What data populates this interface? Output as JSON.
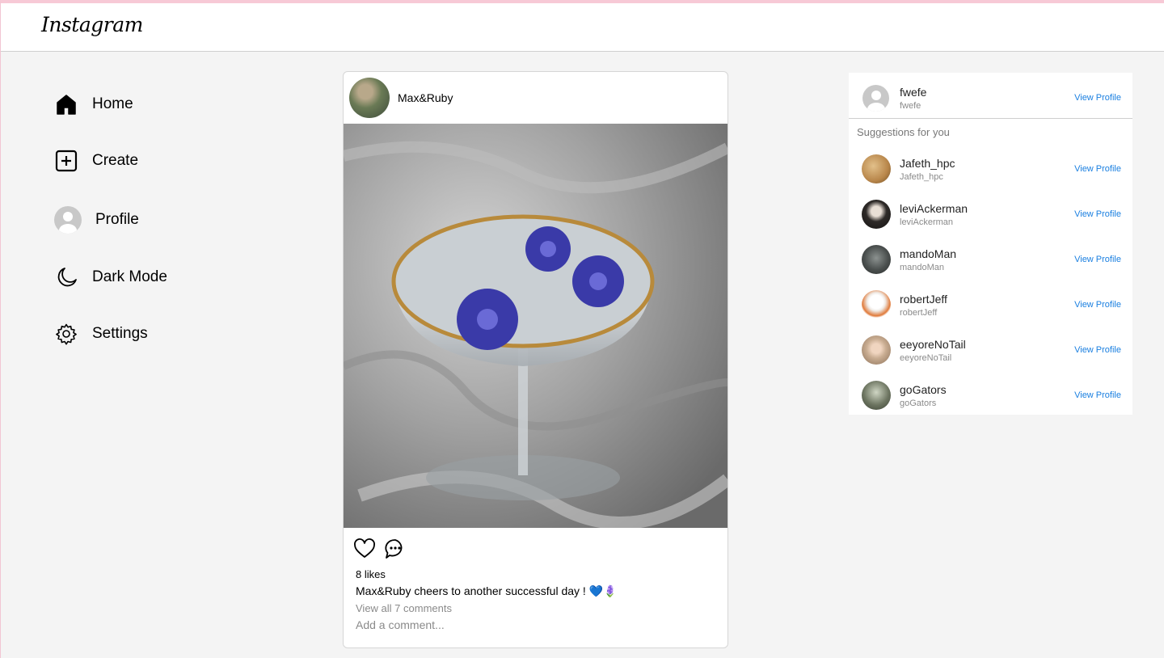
{
  "app": {
    "logo": "Instagram"
  },
  "nav": [
    {
      "label": "Home",
      "icon": "home-icon"
    },
    {
      "label": "Create",
      "icon": "plus-square-icon"
    },
    {
      "label": "Profile",
      "icon": "avatar-icon"
    },
    {
      "label": "Dark Mode",
      "icon": "moon-icon"
    },
    {
      "label": "Settings",
      "icon": "gear-icon"
    }
  ],
  "post": {
    "username": "Max&Ruby",
    "likes": "8 likes",
    "caption_user": "Max&Ruby",
    "caption_text": " cheers to another successful day ! 💙🪻",
    "view_comments": "View all 7 comments",
    "comment_placeholder": "Add a comment..."
  },
  "current_user": {
    "name": "fwefe",
    "handle": "fwefe",
    "link": "View Profile"
  },
  "suggestions_title": "Suggestions for you",
  "suggestions": [
    {
      "name": "Jafeth_hpc",
      "handle": "Jafeth_hpc",
      "link": "View Profile",
      "color": "#b8864a"
    },
    {
      "name": "leviAckerman",
      "handle": "leviAckerman",
      "link": "View Profile",
      "color": "#2e2a28"
    },
    {
      "name": "mandoMan",
      "handle": "mandoMan",
      "link": "View Profile",
      "color": "#4a4f4e"
    },
    {
      "name": "robertJeff",
      "handle": "robertJeff",
      "link": "View Profile",
      "color": "#f0ebe6"
    },
    {
      "name": "eeyoreNoTail",
      "handle": "eeyoreNoTail",
      "link": "View Profile",
      "color": "#c9ad92"
    },
    {
      "name": "goGators",
      "handle": "goGators",
      "link": "View Profile",
      "color": "#6d7561"
    }
  ],
  "colors": {
    "accent": "#1a7fe0",
    "background": "#f4f4f4"
  }
}
